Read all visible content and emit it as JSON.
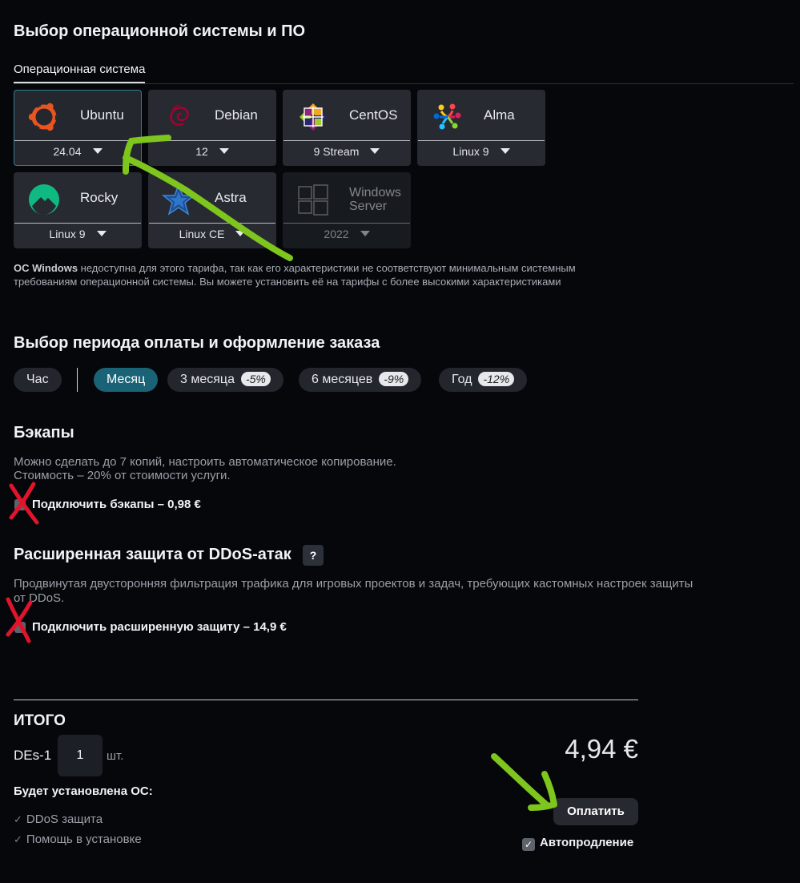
{
  "os_section": {
    "title": "Выбор операционной системы и ПО",
    "tab": "Операционная система",
    "cards": [
      {
        "name": "Ubuntu",
        "version": "24.04",
        "icon": "ubuntu-icon",
        "selected": true
      },
      {
        "name": "Debian",
        "version": "12",
        "icon": "debian-icon"
      },
      {
        "name": "CentOS",
        "version": "9 Stream",
        "icon": "centos-icon"
      },
      {
        "name": "Alma",
        "version": "Linux 9",
        "icon": "alma-icon"
      },
      {
        "name": "Rocky",
        "version": "Linux 9",
        "icon": "rocky-icon"
      },
      {
        "name": "Astra",
        "version": "Linux CE",
        "icon": "astra-icon"
      },
      {
        "name_line1": "Windows",
        "name_line2": "Server",
        "version": "2022",
        "icon": "windows-icon",
        "disabled": true
      }
    ],
    "note_bold": "ОС Windows",
    "note_text": " недоступна для этого тарифа, так как его характеристики не соответствуют минимальным системным требованиям операционной системы. Вы можете установить её на тарифы с более высокими характеристиками"
  },
  "payment": {
    "title": "Выбор периода оплаты и оформление заказа",
    "periods": [
      {
        "label": "Час"
      },
      {
        "label": "Месяц",
        "active": true
      },
      {
        "label": "3 месяца",
        "discount": "-5%"
      },
      {
        "label": "6 месяцев",
        "discount": "-9%"
      },
      {
        "label": "Год",
        "discount": "-12%"
      }
    ]
  },
  "backups": {
    "title": "Бэкапы",
    "desc_line1": "Можно сделать до 7 копий, настроить автоматическое копирование.",
    "desc_line2": "Стоимость – 20% от стоимости услуги.",
    "checkbox_label": "Подключить бэкапы – 0,98 €"
  },
  "ddos": {
    "title": "Расширенная защита от DDoS-атак",
    "help": "?",
    "desc_line1": "Продвинутая двусторонняя фильтрация трафика для игровых проектов и задач, требующих кастомных настроек защиты",
    "desc_line2": "от DDoS.",
    "checkbox_label": "Подключить расширенную защиту – 14,9 €"
  },
  "total": {
    "title": "ИТОГО",
    "plan": "DEs-1",
    "quantity": "1",
    "unit": "шт.",
    "price": "4,94 €",
    "os_label": "Будет установлена ОС:",
    "features": [
      "DDoS защита",
      "Помощь в установке"
    ],
    "pay_button": "Оплатить",
    "autorenew": "Автопродление"
  },
  "colors": {
    "accent": "#1a6377",
    "arrow": "#7ec51e",
    "cross": "#e0142a"
  }
}
